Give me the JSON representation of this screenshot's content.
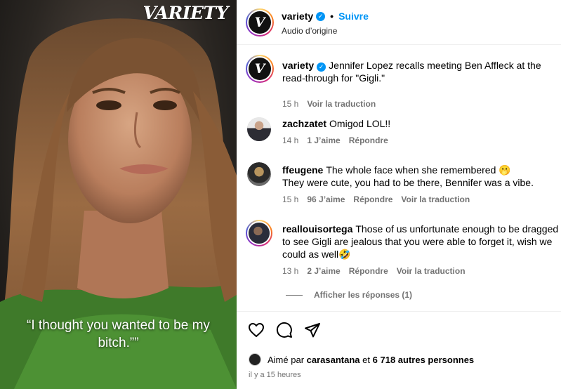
{
  "media": {
    "brand": "VARIETY",
    "caption": "“I thought you wanted to be my bitch.””"
  },
  "header": {
    "username": "variety",
    "separator": "•",
    "follow_label": "Suivre",
    "audio": "Audio d’origine"
  },
  "caption_comment": {
    "username": "variety",
    "text": "Jennifer Lopez recalls meeting Ben Affleck at the read-through for \"Gigli.\"",
    "time": "15 h",
    "translate": "Voir la traduction"
  },
  "comments": [
    {
      "username": "zachzatet",
      "text": "Omigod LOL!!",
      "time": "14 h",
      "likes": "1 J’aime",
      "reply": "Répondre"
    },
    {
      "username": "ffeugene",
      "text": "The whole face when she remembered 🫢",
      "text2": "They were cute, you had to be there, Bennifer was a vibe.",
      "time": "15 h",
      "likes": "96 J’aime",
      "reply": "Répondre",
      "translate": "Voir la traduction"
    },
    {
      "username": "reallouisortega",
      "text": "Those of us unfortunate enough to be dragged to see Gigli are jealous that you were able to forget it, wish we could as well🤣",
      "time": "13 h",
      "likes": "2 J’aime",
      "reply": "Répondre",
      "translate": "Voir la traduction"
    }
  ],
  "show_replies": "Afficher les réponses (1)",
  "likes_line": {
    "prefix": "Aimé par",
    "user": "carasantana",
    "middle": "et",
    "count": "6 718 autres personnes"
  },
  "timestamp": "il y a 15 heures",
  "icons": [
    "heart-icon",
    "comment-icon",
    "share-icon",
    "verified-badge-icon"
  ],
  "colors": {
    "accent": "#0095f6",
    "muted": "#737373"
  }
}
